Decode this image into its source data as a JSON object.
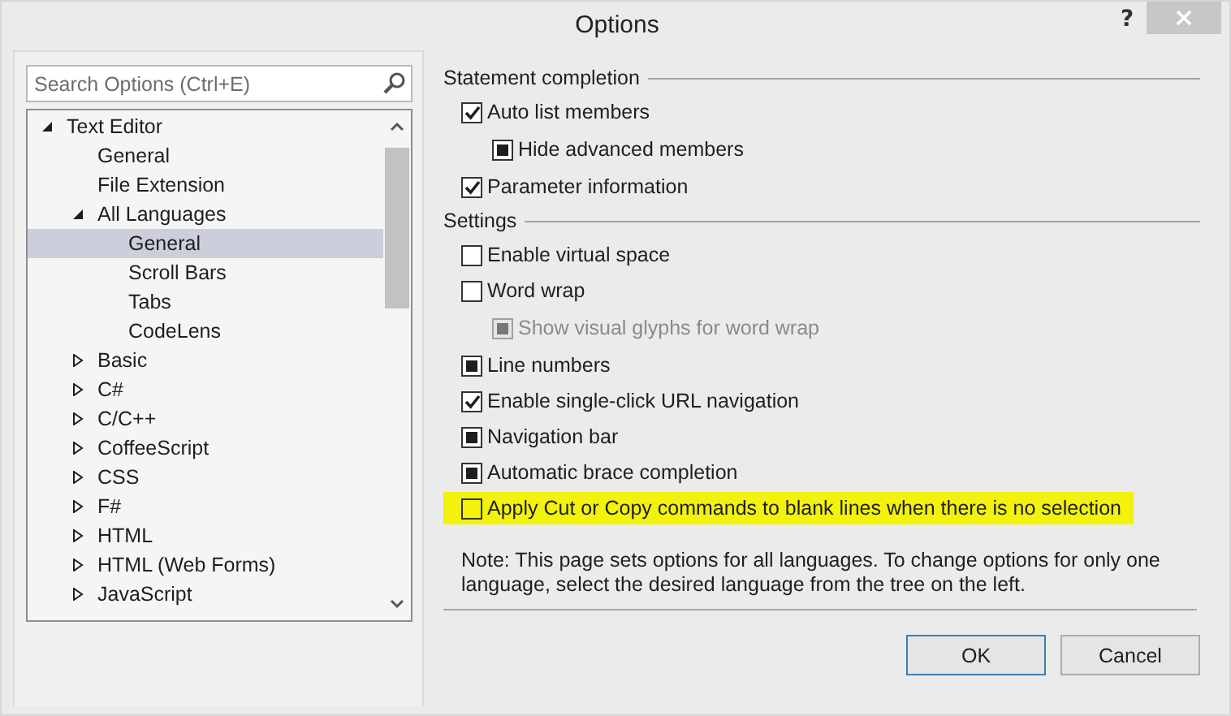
{
  "window": {
    "title": "Options",
    "help": "?"
  },
  "search": {
    "placeholder": "Search Options (Ctrl+E)"
  },
  "tree": [
    {
      "label": "Text Editor",
      "kind": "node",
      "expanded": true,
      "selected": false,
      "children": [
        {
          "label": "General",
          "kind": "leaf",
          "selected": false
        },
        {
          "label": "File Extension",
          "kind": "leaf",
          "selected": false
        },
        {
          "label": "All Languages",
          "kind": "node",
          "expanded": true,
          "selected": false,
          "children": [
            {
              "label": "General",
              "kind": "leaf",
              "selected": true
            },
            {
              "label": "Scroll Bars",
              "kind": "leaf",
              "selected": false
            },
            {
              "label": "Tabs",
              "kind": "leaf",
              "selected": false
            },
            {
              "label": "CodeLens",
              "kind": "leaf",
              "selected": false
            }
          ]
        },
        {
          "label": "Basic",
          "kind": "node",
          "expanded": false,
          "selected": false
        },
        {
          "label": "C#",
          "kind": "node",
          "expanded": false,
          "selected": false
        },
        {
          "label": "C/C++",
          "kind": "node",
          "expanded": false,
          "selected": false
        },
        {
          "label": "CoffeeScript",
          "kind": "node",
          "expanded": false,
          "selected": false
        },
        {
          "label": "CSS",
          "kind": "node",
          "expanded": false,
          "selected": false
        },
        {
          "label": "F#",
          "kind": "node",
          "expanded": false,
          "selected": false
        },
        {
          "label": "HTML",
          "kind": "node",
          "expanded": false,
          "selected": false
        },
        {
          "label": "HTML (Web Forms)",
          "kind": "node",
          "expanded": false,
          "selected": false
        },
        {
          "label": "JavaScript",
          "kind": "node",
          "expanded": false,
          "selected": false
        }
      ]
    }
  ],
  "groups": [
    {
      "title": "Statement completion",
      "options": [
        {
          "label": "Auto list members",
          "checked": true,
          "mixed": false,
          "disabled": false,
          "highlighted": false,
          "children": [
            {
              "label": "Hide advanced members",
              "checked": false,
              "mixed": true,
              "disabled": false,
              "highlighted": false
            }
          ]
        },
        {
          "label": "Parameter information",
          "checked": true,
          "mixed": false,
          "disabled": false,
          "highlighted": false
        }
      ]
    },
    {
      "title": "Settings",
      "options": [
        {
          "label": "Enable virtual space",
          "checked": false,
          "mixed": false,
          "disabled": false,
          "highlighted": false
        },
        {
          "label": "Word wrap",
          "checked": false,
          "mixed": false,
          "disabled": false,
          "highlighted": false,
          "children": [
            {
              "label": "Show visual glyphs for word wrap",
              "checked": false,
              "mixed": true,
              "disabled": true,
              "highlighted": false
            }
          ]
        },
        {
          "label": "Line numbers",
          "checked": false,
          "mixed": true,
          "disabled": false,
          "highlighted": false
        },
        {
          "label": "Enable single-click URL navigation",
          "checked": true,
          "mixed": false,
          "disabled": false,
          "highlighted": false
        },
        {
          "label": "Navigation bar",
          "checked": false,
          "mixed": true,
          "disabled": false,
          "highlighted": false
        },
        {
          "label": "Automatic brace completion",
          "checked": false,
          "mixed": true,
          "disabled": false,
          "highlighted": false
        },
        {
          "label": "Apply Cut or Copy commands to blank lines when there is no selection",
          "checked": false,
          "mixed": false,
          "disabled": false,
          "highlighted": true
        }
      ]
    }
  ],
  "note": "Note: This page sets options for all languages. To change options for only one language, select the desired language from the tree on the left.",
  "buttons": [
    {
      "label": "OK",
      "default": true
    },
    {
      "label": "Cancel",
      "default": false
    }
  ]
}
